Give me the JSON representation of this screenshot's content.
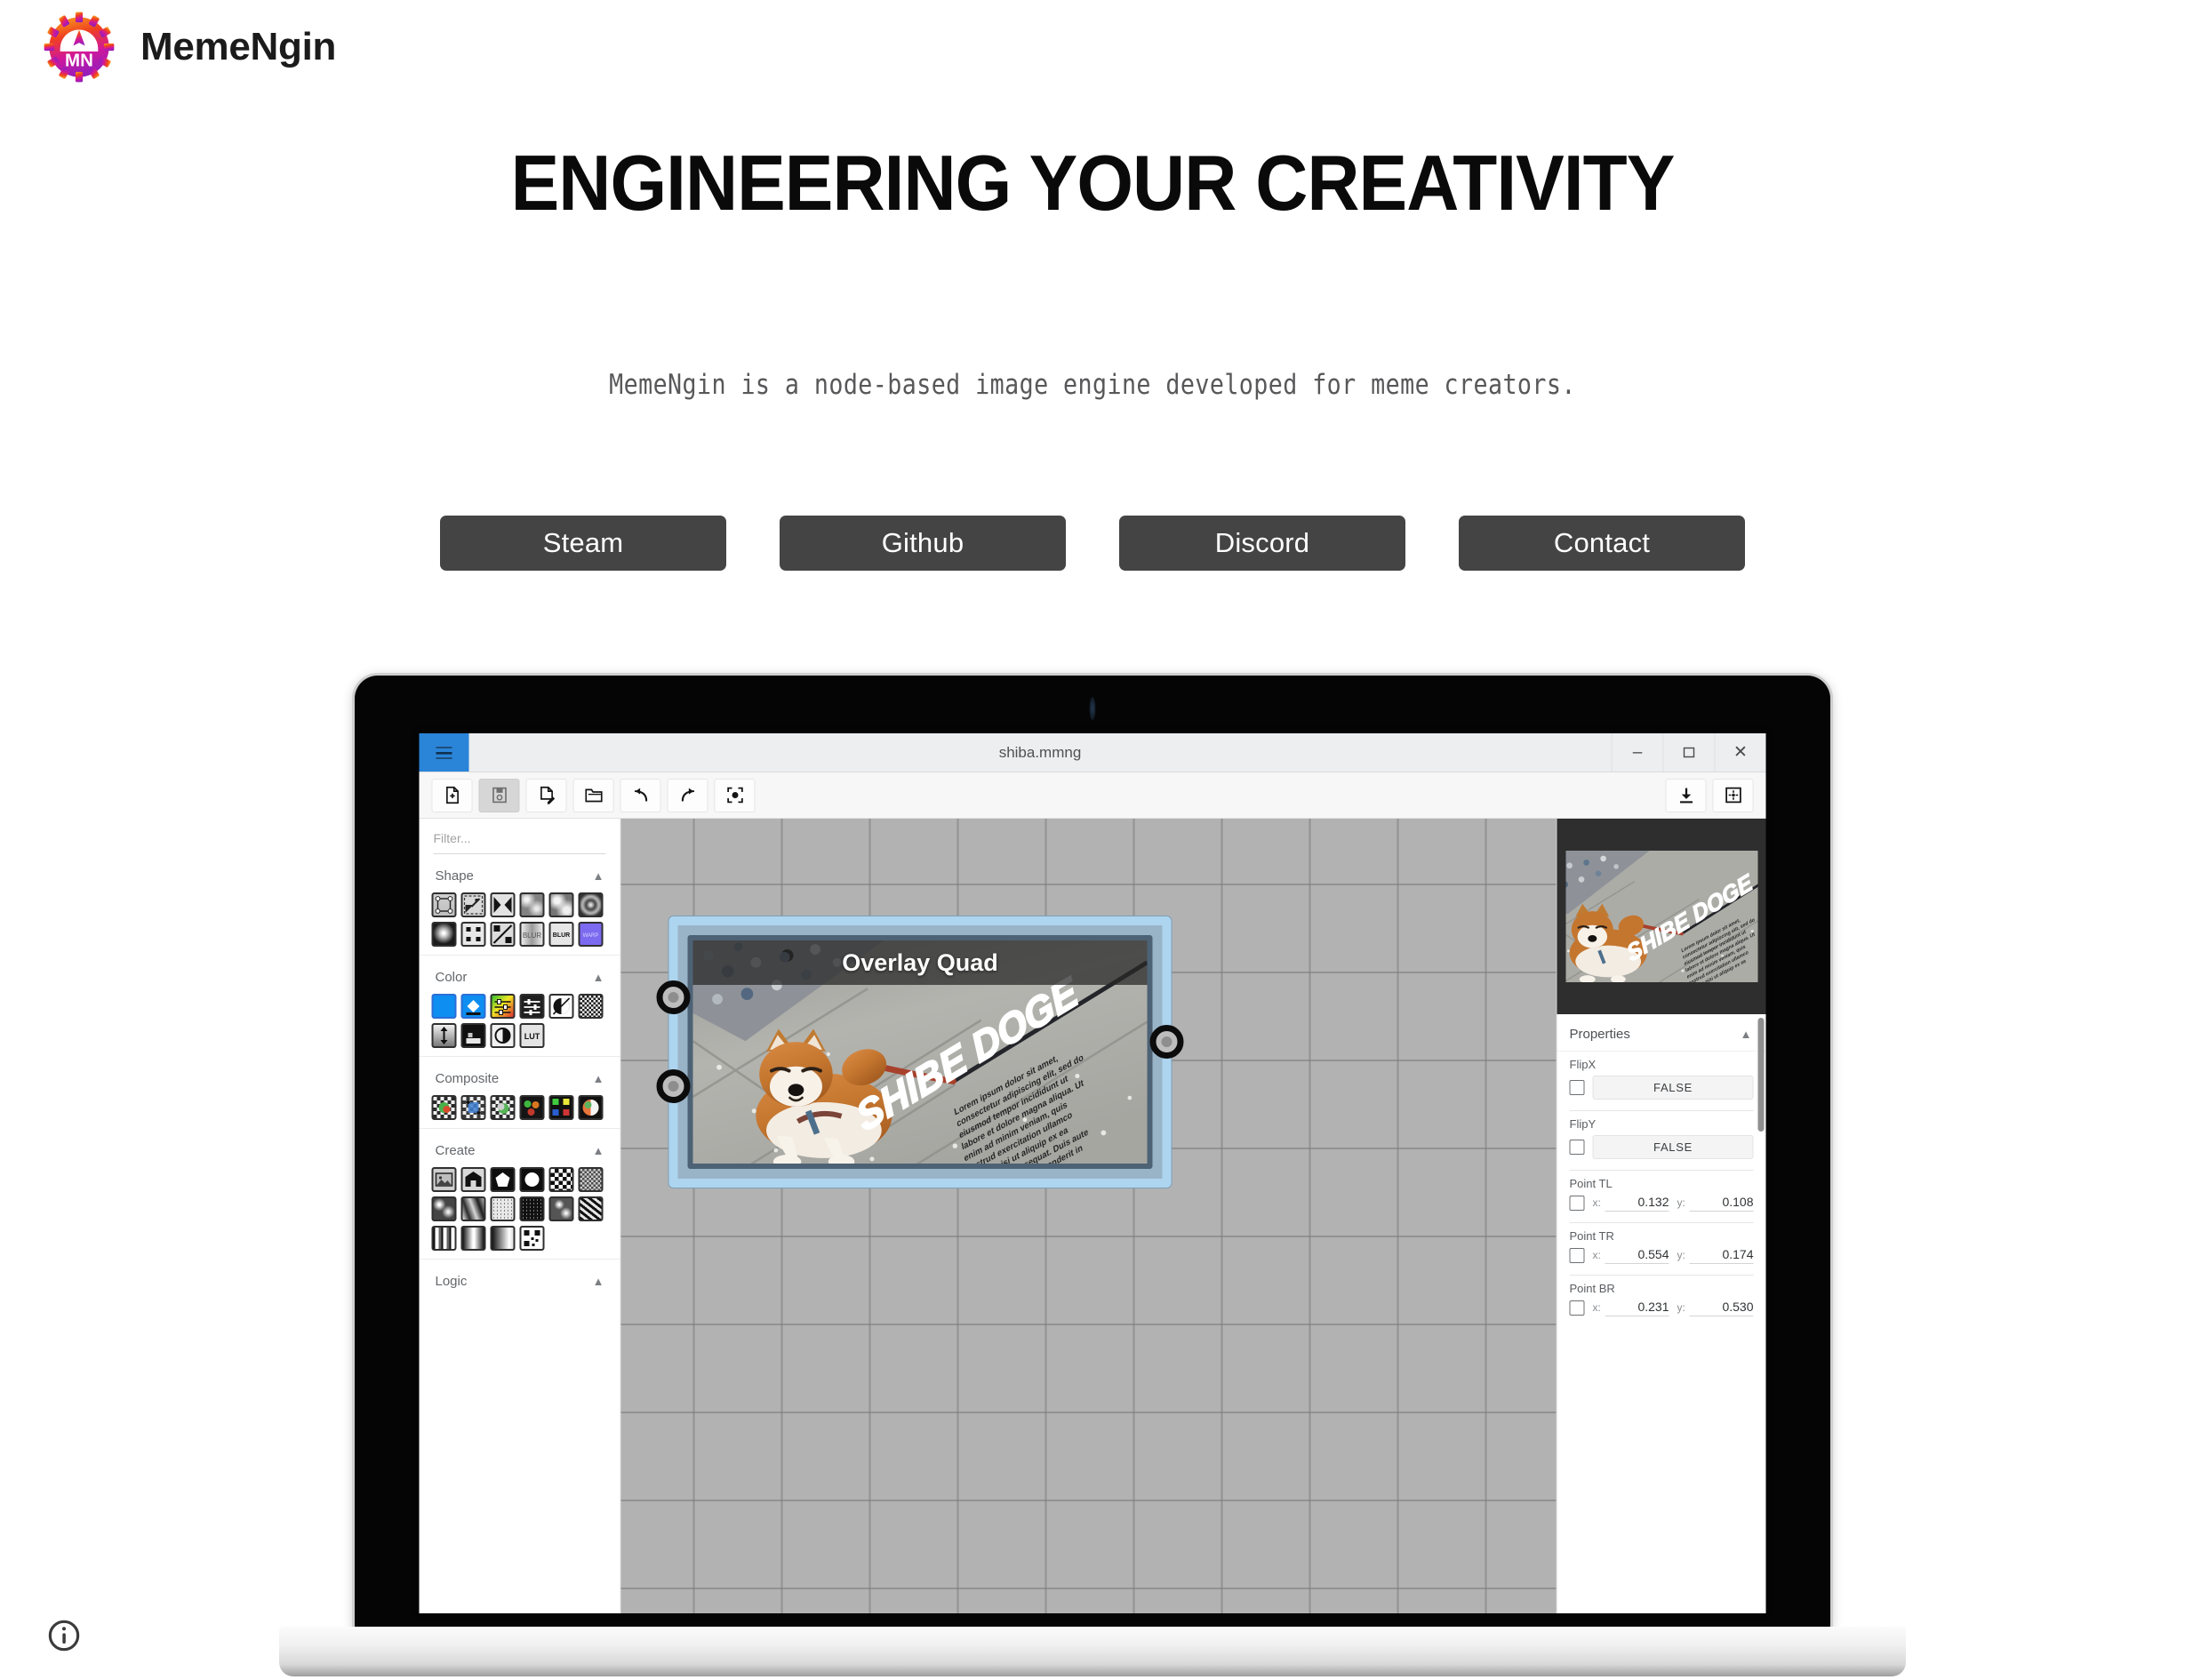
{
  "brand": {
    "name": "MemeNgin",
    "logo_icon": "memengin-gear-logo",
    "logo_gradient_from": "#F26B21",
    "logo_gradient_to": "#8E1FBE",
    "logo_initials": "MN"
  },
  "hero": {
    "title": "ENGINEERING YOUR CREATIVITY",
    "tagline": "MemeNgin is a node-based image engine developed for meme creators."
  },
  "cta_buttons": [
    {
      "label": "Steam",
      "name": "steam-button"
    },
    {
      "label": "Github",
      "name": "github-button"
    },
    {
      "label": "Discord",
      "name": "discord-button"
    },
    {
      "label": "Contact",
      "name": "contact-button"
    }
  ],
  "theme": {
    "button_bg": "#444444",
    "button_text": "#ffffff",
    "heading_color": "#0a0a0a",
    "tagline_color": "#58585a",
    "page_bg": "#ffffff"
  },
  "footer": {
    "info_icon": "info-circle-icon"
  },
  "app": {
    "window_title": "shiba.mmng",
    "menu_icon": "hamburger-menu-icon",
    "window_controls": [
      {
        "label": "–",
        "name": "minimize-button"
      },
      {
        "label": "❐",
        "name": "maximize-button"
      },
      {
        "label": "✕",
        "name": "close-button"
      }
    ],
    "toolbar": {
      "left_buttons": [
        {
          "name": "new-file-icon",
          "title": "New"
        },
        {
          "name": "save-icon",
          "title": "Save",
          "active": true
        },
        {
          "name": "save-as-icon",
          "title": "Save As"
        },
        {
          "name": "open-folder-icon",
          "title": "Open"
        },
        {
          "name": "undo-icon",
          "title": "Undo"
        },
        {
          "name": "redo-icon",
          "title": "Redo"
        },
        {
          "name": "center-view-icon",
          "title": "Center View"
        }
      ],
      "right_buttons": [
        {
          "name": "export-icon",
          "title": "Export"
        },
        {
          "name": "resize-icon",
          "title": "Resize"
        }
      ]
    },
    "library": {
      "filter_placeholder": "Filter...",
      "sections": [
        {
          "label": "Shape",
          "collapse_icon": "chevron-up-icon",
          "rows": [
            6,
            6
          ]
        },
        {
          "label": "Color",
          "collapse_icon": "chevron-up-icon",
          "rows": [
            6,
            4
          ]
        },
        {
          "label": "Composite",
          "collapse_icon": "chevron-up-icon",
          "rows": [
            6
          ]
        },
        {
          "label": "Create",
          "collapse_icon": "chevron-up-icon",
          "rows": [
            6,
            6,
            4
          ]
        },
        {
          "label": "Logic",
          "collapse_icon": "chevron-up-icon",
          "rows": []
        }
      ]
    },
    "canvas": {
      "node_title": "Overlay Quad",
      "meme_text": "SHIBE DOGE",
      "body_text": "Lorem ipsum dolor sit amet, consectetur adipiscing elit, sed do eiusmod tempor incididunt ut labore et dolore magna aliqua. Ut enim ad minim veniam, quis nostrud exercitation ullamco laboris nisi ut aliquip ex ea commodo consequat. Duis aute irure dolor in reprehenderit in voluptate."
    },
    "properties": {
      "header": "Properties",
      "collapse_icon": "chevron-up-icon",
      "fields": [
        {
          "label": "FlipX",
          "type": "bool",
          "value": "FALSE"
        },
        {
          "label": "FlipY",
          "type": "bool",
          "value": "FALSE"
        },
        {
          "label": "Point TL",
          "type": "vec2",
          "x_key": "x:",
          "y_key": "y:",
          "x": "0.132",
          "y": "0.108"
        },
        {
          "label": "Point TR",
          "type": "vec2",
          "x_key": "x:",
          "y_key": "y:",
          "x": "0.554",
          "y": "0.174"
        },
        {
          "label": "Point BR",
          "type": "vec2",
          "x_key": "x:",
          "y_key": "y:",
          "x": "0.231",
          "y": "0.530"
        }
      ]
    }
  }
}
